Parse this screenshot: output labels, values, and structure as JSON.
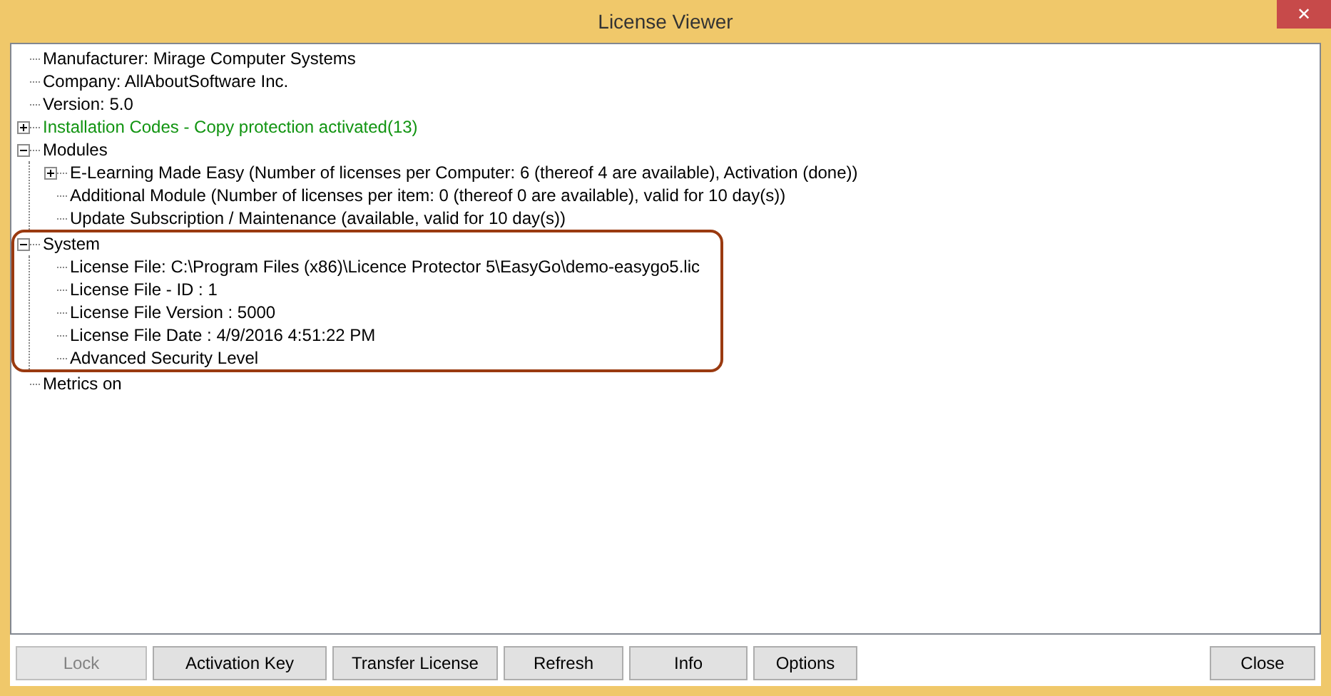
{
  "window": {
    "title": "License Viewer",
    "close_glyph": "✕"
  },
  "tree": [
    {
      "text": "Manufacturer: Mirage Computer Systems"
    },
    {
      "text": "Company: AllAboutSoftware Inc."
    },
    {
      "text": "Version: 5.0"
    },
    {
      "text": "Installation Codes - Copy protection activated(13)",
      "color": "#119411",
      "expanded": false
    },
    {
      "text": "Modules",
      "expanded": true,
      "children": [
        {
          "text": "E-Learning Made Easy (Number of licenses per Computer: 6 (thereof 4 are available), Activation (done))",
          "expanded": false
        },
        {
          "text": "Additional Module (Number of licenses per item: 0 (thereof 0 are available), valid for 10 day(s))"
        },
        {
          "text": "Update Subscription / Maintenance (available, valid for 10 day(s))"
        }
      ]
    },
    {
      "text": "System",
      "expanded": true,
      "highlighted": true,
      "children": [
        {
          "text": "License File: C:\\Program Files (x86)\\Licence Protector 5\\EasyGo\\demo-easygo5.lic"
        },
        {
          "text": "License File - ID : 1"
        },
        {
          "text": "License File Version : 5000"
        },
        {
          "text": "License File Date : 4/9/2016 4:51:22 PM"
        },
        {
          "text": "Advanced Security Level"
        }
      ]
    },
    {
      "text": "Metrics on"
    }
  ],
  "buttons": [
    {
      "label": "Lock",
      "disabled": true,
      "kind": "action"
    },
    {
      "label": "Activation Key",
      "disabled": false,
      "kind": "action"
    },
    {
      "label": "Transfer License",
      "disabled": false,
      "kind": "action"
    },
    {
      "label": "Refresh",
      "disabled": false,
      "kind": "action"
    },
    {
      "label": "Info",
      "disabled": false,
      "kind": "action"
    },
    {
      "label": "Options",
      "disabled": false,
      "kind": "action"
    },
    {
      "label": "Close",
      "disabled": false,
      "kind": "dismiss"
    }
  ]
}
